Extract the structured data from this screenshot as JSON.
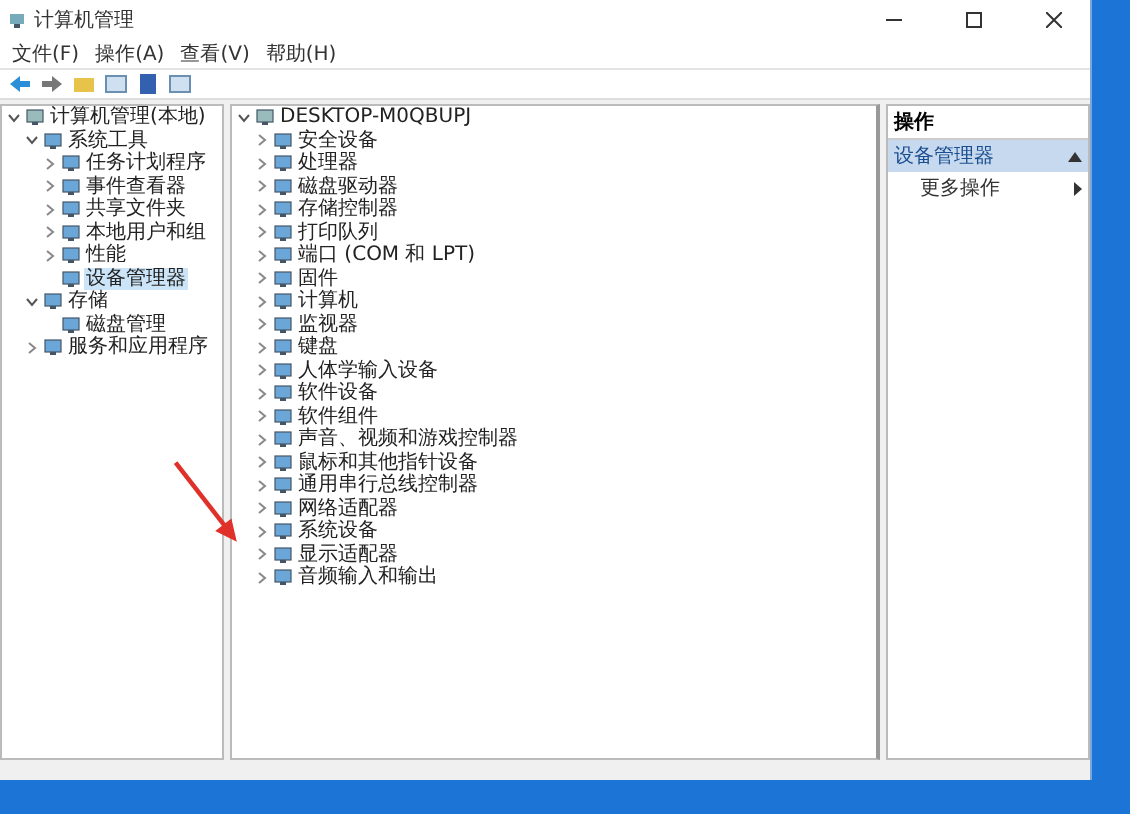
{
  "window": {
    "title": "计算机管理"
  },
  "menu": [
    "文件(F)",
    "操作(A)",
    "查看(V)",
    "帮助(H)"
  ],
  "nav_tree": [
    {
      "label": "计算机管理(本地)",
      "expanded": true,
      "selected": false,
      "children": [
        {
          "label": "系统工具",
          "expanded": true,
          "selected": false,
          "children": [
            {
              "label": "任务计划程序",
              "expanded": false,
              "selected": false
            },
            {
              "label": "事件查看器",
              "expanded": false,
              "selected": false
            },
            {
              "label": "共享文件夹",
              "expanded": false,
              "selected": false
            },
            {
              "label": "本地用户和组",
              "expanded": false,
              "selected": false
            },
            {
              "label": "性能",
              "expanded": false,
              "selected": false
            },
            {
              "label": "设备管理器",
              "selected": true
            }
          ]
        },
        {
          "label": "存储",
          "expanded": true,
          "selected": false,
          "children": [
            {
              "label": "磁盘管理",
              "selected": false
            }
          ]
        },
        {
          "label": "服务和应用程序",
          "expanded": false,
          "selected": false
        }
      ]
    }
  ],
  "device_tree": [
    {
      "label": "DESKTOP-M0QBUPJ",
      "expanded": true,
      "children": [
        {
          "label": "安全设备",
          "expanded": false
        },
        {
          "label": "处理器",
          "expanded": false
        },
        {
          "label": "磁盘驱动器",
          "expanded": false
        },
        {
          "label": "存储控制器",
          "expanded": false
        },
        {
          "label": "打印队列",
          "expanded": false
        },
        {
          "label": "端口 (COM 和 LPT)",
          "expanded": false
        },
        {
          "label": "固件",
          "expanded": false
        },
        {
          "label": "计算机",
          "expanded": false
        },
        {
          "label": "监视器",
          "expanded": false
        },
        {
          "label": "键盘",
          "expanded": false
        },
        {
          "label": "人体学输入设备",
          "expanded": false
        },
        {
          "label": "软件设备",
          "expanded": false
        },
        {
          "label": "软件组件",
          "expanded": false
        },
        {
          "label": "声音、视频和游戏控制器",
          "expanded": false
        },
        {
          "label": "鼠标和其他指针设备",
          "expanded": false
        },
        {
          "label": "通用串行总线控制器",
          "expanded": false
        },
        {
          "label": "网络适配器",
          "expanded": false
        },
        {
          "label": "系统设备",
          "expanded": false
        },
        {
          "label": "显示适配器",
          "expanded": false
        },
        {
          "label": "音频输入和输出",
          "expanded": false
        }
      ]
    }
  ],
  "actions": {
    "title": "操作",
    "section": "设备管理器",
    "items": [
      "更多操作"
    ]
  }
}
